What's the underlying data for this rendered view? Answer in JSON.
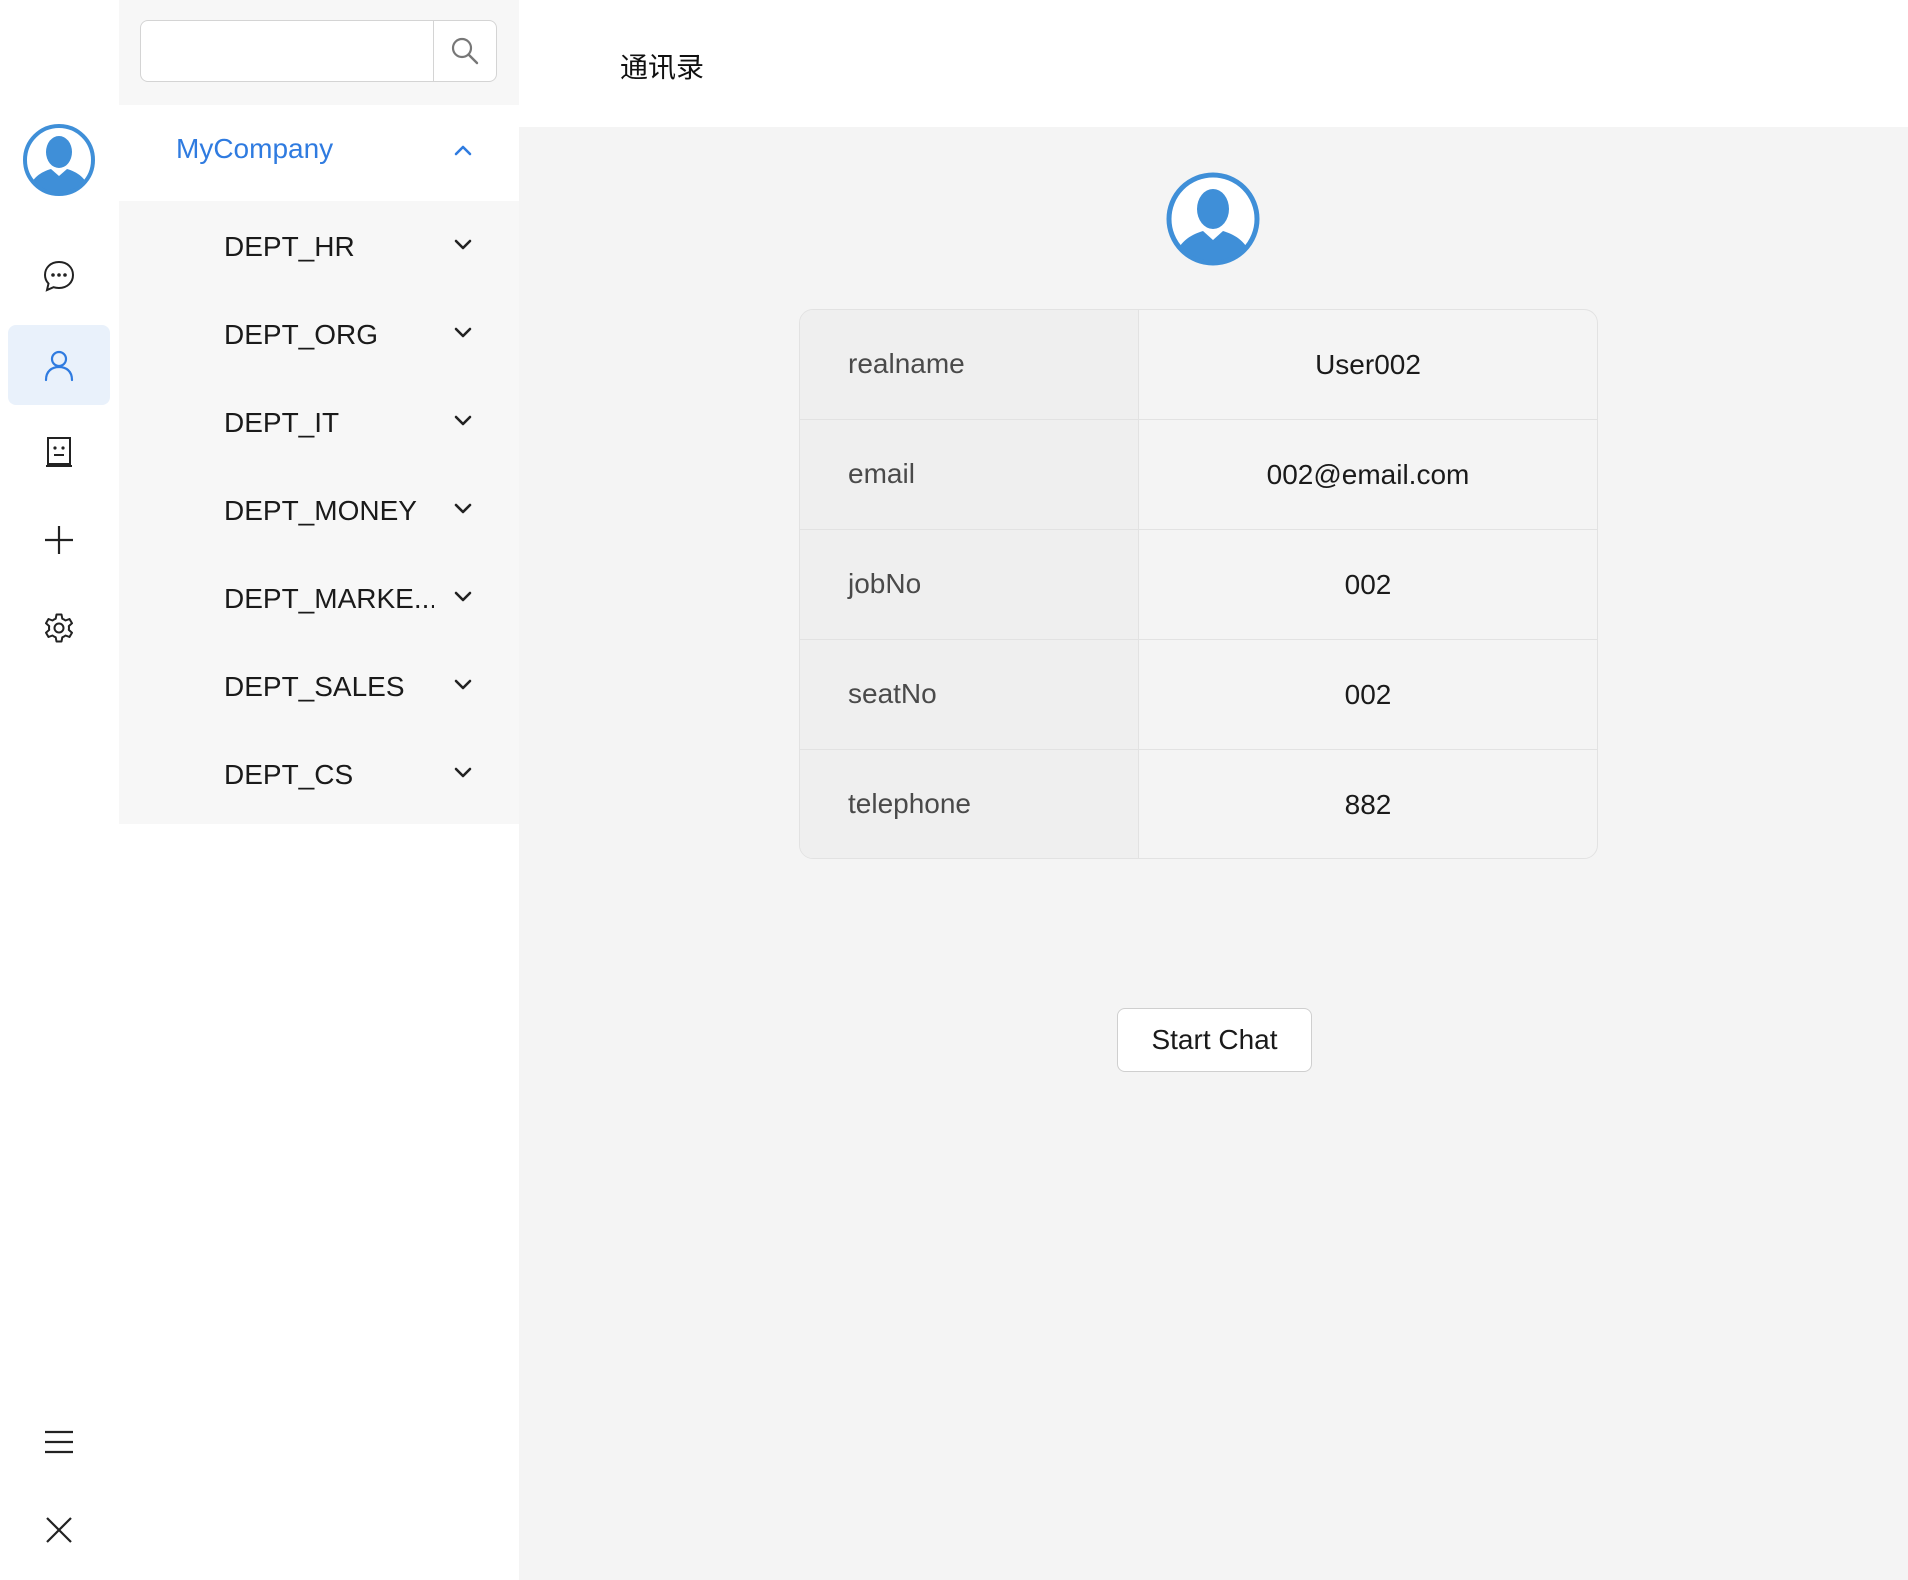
{
  "window": {
    "controls": [
      "close",
      "minimize",
      "maximize"
    ]
  },
  "rail": {
    "items": [
      {
        "icon": "chat-bubble-icon",
        "active": false
      },
      {
        "icon": "person-icon",
        "active": true
      },
      {
        "icon": "contact-card-icon",
        "active": false
      },
      {
        "icon": "plus-icon",
        "active": false
      },
      {
        "icon": "gear-icon",
        "active": false
      }
    ],
    "bottom_items": [
      {
        "icon": "hamburger-menu-icon"
      },
      {
        "icon": "close-icon"
      }
    ]
  },
  "search": {
    "value": "",
    "placeholder": ""
  },
  "company": {
    "label": "MyCompany",
    "expanded": true
  },
  "departments": [
    {
      "label": "DEPT_HR"
    },
    {
      "label": "DEPT_ORG"
    },
    {
      "label": "DEPT_IT"
    },
    {
      "label": "DEPT_MONEY"
    },
    {
      "label": "DEPT_MARKE..."
    },
    {
      "label": "DEPT_SALES"
    },
    {
      "label": "DEPT_CS"
    }
  ],
  "main": {
    "title": "通讯录",
    "profile": {
      "fields": [
        {
          "key": "realname",
          "value": "User002"
        },
        {
          "key": "email",
          "value": "002@email.com"
        },
        {
          "key": "jobNo",
          "value": "002"
        },
        {
          "key": "seatNo",
          "value": "002"
        },
        {
          "key": "telephone",
          "value": "882"
        }
      ]
    },
    "start_chat_label": "Start Chat"
  },
  "colors": {
    "accent": "#2f7be0",
    "avatar_blue": "#3f8fd8",
    "active_bg": "#e9f1fb"
  }
}
